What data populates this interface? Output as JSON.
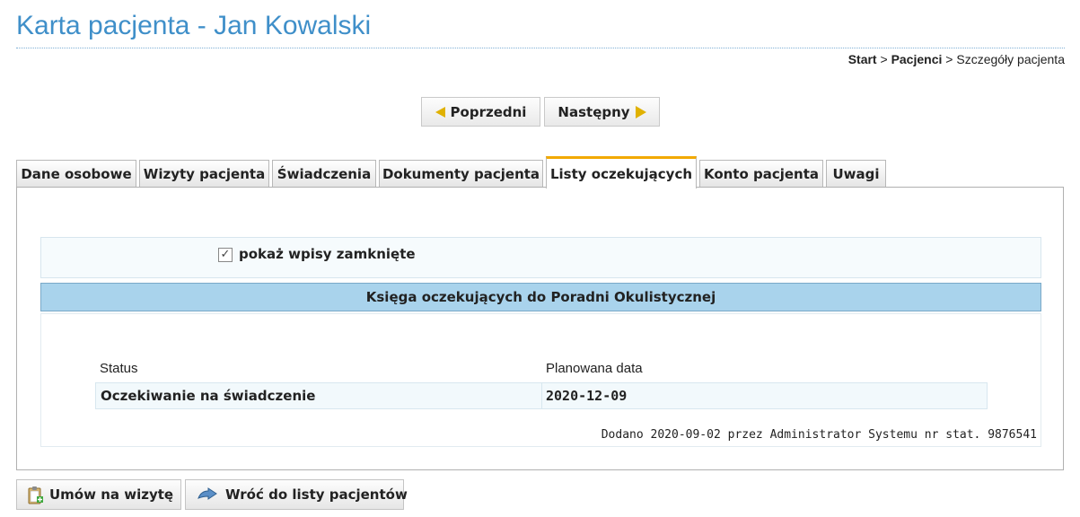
{
  "page": {
    "title": "Karta pacjenta - Jan Kowalski"
  },
  "breadcrumb": {
    "start": "Start",
    "sep1": " > ",
    "patients": "Pacjenci",
    "sep2": " > ",
    "current": "Szczegóły pacjenta"
  },
  "nav": {
    "prev_label": "Poprzedni",
    "next_label": "Następny"
  },
  "tabs": [
    {
      "label": "Dane osobowe"
    },
    {
      "label": "Wizyty pacjenta"
    },
    {
      "label": "Świadczenia"
    },
    {
      "label": "Dokumenty pacjenta"
    },
    {
      "label": "Listy oczekujących"
    },
    {
      "label": "Konto pacjenta"
    },
    {
      "label": "Uwagi"
    }
  ],
  "active_tab": "Listy oczekujących",
  "filter": {
    "checked": true,
    "label": "pokaż wpisy zamknięte"
  },
  "waitlist": {
    "title": "Księga oczekujących do Poradni Okulistycznej",
    "columns": [
      "Status",
      "Planowana data"
    ],
    "rows": [
      {
        "status": "Oczekiwanie na świadczenie",
        "date": "2020-12-09"
      }
    ],
    "added_note": "Dodano 2020-09-02 przez Administrator Systemu nr stat. 9876541"
  },
  "actions": {
    "book_label": "Umów na wizytę",
    "back_label": "Wróć do listy pacjentów"
  },
  "colors": {
    "title": "#3f8fc9",
    "tab_active_accent": "#f2a900",
    "section_header_bg": "#a9d3ec"
  }
}
